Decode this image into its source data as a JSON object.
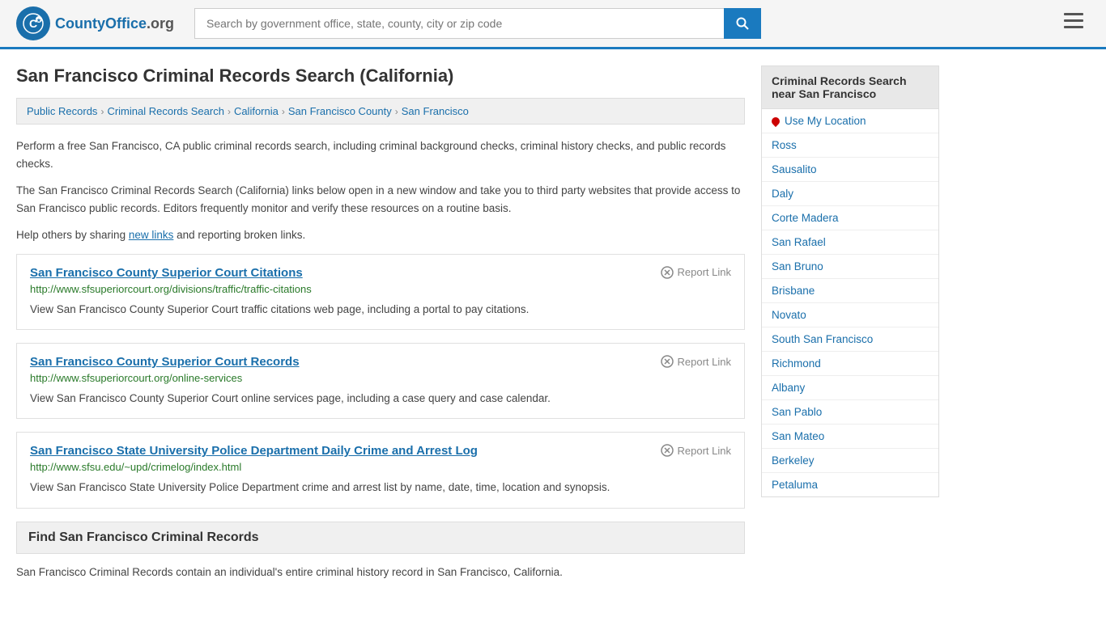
{
  "header": {
    "logo_text": "CountyOffice",
    "logo_suffix": ".org",
    "search_placeholder": "Search by government office, state, county, city or zip code",
    "search_value": ""
  },
  "page": {
    "title": "San Francisco Criminal Records Search (California)",
    "description1": "Perform a free San Francisco, CA public criminal records search, including criminal background checks, criminal history checks, and public records checks.",
    "description2": "The San Francisco Criminal Records Search (California) links below open in a new window and take you to third party websites that provide access to San Francisco public records. Editors frequently monitor and verify these resources on a routine basis.",
    "description3_before": "Help others by sharing ",
    "description3_link": "new links",
    "description3_after": " and reporting broken links."
  },
  "breadcrumb": {
    "items": [
      {
        "label": "Public Records",
        "href": "#"
      },
      {
        "label": "Criminal Records Search",
        "href": "#"
      },
      {
        "label": "California",
        "href": "#"
      },
      {
        "label": "San Francisco County",
        "href": "#"
      },
      {
        "label": "San Francisco",
        "href": "#"
      }
    ]
  },
  "results": [
    {
      "title": "San Francisco County Superior Court Citations",
      "url": "http://www.sfsuperiorcourt.org/divisions/traffic/traffic-citations",
      "description": "View San Francisco County Superior Court traffic citations web page, including a portal to pay citations.",
      "report_label": "Report Link"
    },
    {
      "title": "San Francisco County Superior Court Records",
      "url": "http://www.sfsuperiorcourt.org/online-services",
      "description": "View San Francisco County Superior Court online services page, including a case query and case calendar.",
      "report_label": "Report Link"
    },
    {
      "title": "San Francisco State University Police Department Daily Crime and Arrest Log",
      "url": "http://www.sfsu.edu/~upd/crimelog/index.html",
      "description": "View San Francisco State University Police Department crime and arrest list by name, date, time, location and synopsis.",
      "report_label": "Report Link"
    }
  ],
  "section": {
    "heading": "Find San Francisco Criminal Records",
    "text": "San Francisco Criminal Records contain an individual's entire criminal history record in San Francisco, California."
  },
  "sidebar": {
    "title": "Criminal Records Search near San Francisco",
    "use_my_location": "Use My Location",
    "locations": [
      "Ross",
      "Sausalito",
      "Daly",
      "Corte Madera",
      "San Rafael",
      "San Bruno",
      "Brisbane",
      "Novato",
      "South San Francisco",
      "Richmond",
      "Albany",
      "San Pablo",
      "San Mateo",
      "Berkeley",
      "Petaluma"
    ]
  }
}
